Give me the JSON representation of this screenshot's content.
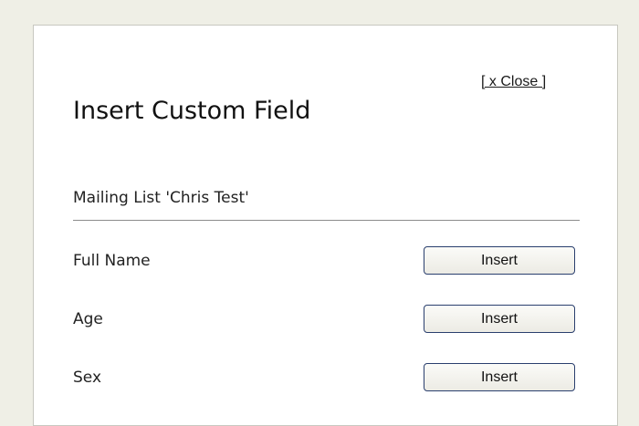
{
  "dialog": {
    "close_label": "[ x Close ]",
    "title": "Insert Custom Field",
    "list_heading": "Mailing List 'Chris Test'",
    "fields": [
      {
        "label": "Full Name",
        "button_label": "Insert"
      },
      {
        "label": "Age",
        "button_label": "Insert"
      },
      {
        "label": "Sex",
        "button_label": "Insert"
      }
    ]
  }
}
